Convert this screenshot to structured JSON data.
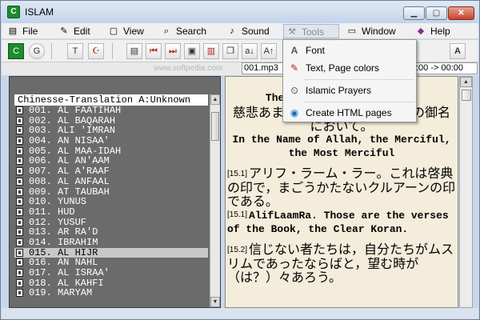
{
  "window": {
    "title": "ISLAM",
    "app_icon_letter": "C"
  },
  "menu": [
    {
      "label": "File",
      "icon": "file-icon",
      "glyph": "▤"
    },
    {
      "label": "Edit",
      "icon": "edit-icon",
      "glyph": "✎"
    },
    {
      "label": "View",
      "icon": "view-icon",
      "glyph": "▢"
    },
    {
      "label": "Search",
      "icon": "search-icon",
      "glyph": "⌕"
    },
    {
      "label": "Sound",
      "icon": "speaker-icon",
      "glyph": "♪"
    },
    {
      "label": "Tools",
      "icon": "tools-icon",
      "glyph": "⚒"
    },
    {
      "label": "Window",
      "icon": "window-icon",
      "glyph": "▭"
    },
    {
      "label": "Help",
      "icon": "help-book-icon",
      "glyph": "◆"
    }
  ],
  "toolbar": {
    "file_field": "001.mp3",
    "time_field": ":00 -> 00:00",
    "watermark": "www.softpedia.com"
  },
  "tools_menu": [
    {
      "label": "Font",
      "icon": "font-icon",
      "glyph": "A"
    },
    {
      "label": "Text, Page colors",
      "icon": "colors-icon",
      "glyph": "✎"
    },
    {
      "label": "Islamic Prayers",
      "icon": "prayers-icon",
      "glyph": "⏲"
    },
    {
      "label": "Create HTML pages",
      "icon": "globe-icon",
      "glyph": "◉"
    }
  ],
  "left": {
    "header": "Chinesse-Translation A:Unknown",
    "suras": [
      "001. AL FAATIHAH",
      "002. AL BAQARAH",
      "003. ALI 'IMRAN",
      "004. AN NISAA'",
      "005. AL MAA-IDAH",
      "006. AL AN'AAM",
      "007. AL A'RAAF",
      "008. AL ANFAAL",
      "009. AT TAUBAH",
      "010. YUNUS",
      "011. HUD",
      "012. YUSUF",
      "013. AR RA'D",
      "014. IBRAHIM",
      "015. AL HIJR",
      "016. AN NAHL",
      "017. AL ISRAA'",
      "018. AL KAHFI",
      "019. MARYAM"
    ],
    "selected_index": 14
  },
  "right": {
    "title": "The Va",
    "title_tail": "ijr",
    "bismillah_jp": "慈悲あまねく慈愛深きアッラーの御名において。",
    "bismillah_en": "In the Name of Allah, the Merciful, the Most Merciful",
    "verses": [
      {
        "ref": "[15.1]",
        "jp": "アリフ・ラーム・ラー。これは啓典の印で，まごうかたないクルアーンの印である。"
      },
      {
        "ref": "[15.1]",
        "en": "AlifLaamRa. Those are the verses of the Book, the Clear Koran."
      },
      {
        "ref": "[15.2]",
        "jp": "信じない者たちは，自分たちがムスリムであったならばと，望む時が（は？）々あろう。"
      }
    ]
  }
}
